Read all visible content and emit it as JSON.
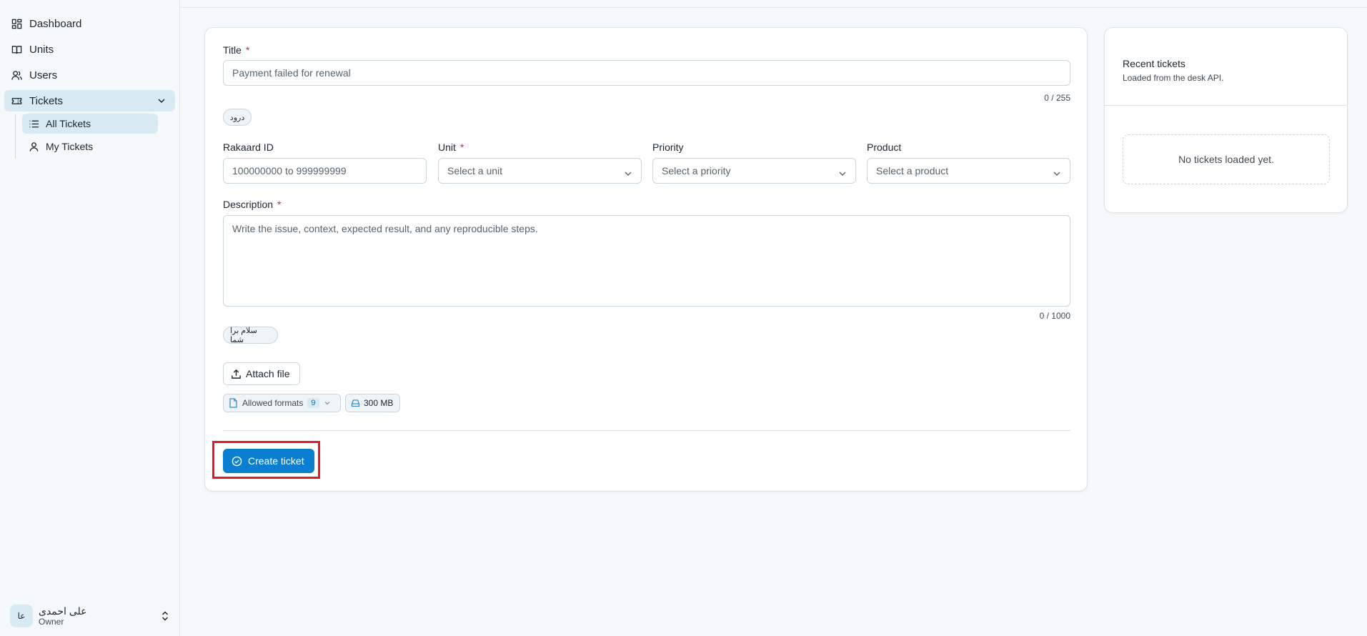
{
  "sidebar": {
    "items": [
      {
        "label": "Dashboard",
        "icon": "dashboard-icon"
      },
      {
        "label": "Units",
        "icon": "book-icon"
      },
      {
        "label": "Users",
        "icon": "users-icon"
      },
      {
        "label": "Tickets",
        "icon": "ticket-icon"
      }
    ],
    "tickets_sub": [
      {
        "label": "All Tickets",
        "icon": "list-icon"
      },
      {
        "label": "My Tickets",
        "icon": "user-icon"
      }
    ],
    "user": {
      "initials": "عا",
      "name": "علی احمدی",
      "role": "Owner"
    }
  },
  "form": {
    "title_label": "Title",
    "title_value": "Payment failed for renewal",
    "title_counter": "0 / 255",
    "title_chip": "درود",
    "rakaard_label": "Rakaard ID",
    "rakaard_placeholder": "100000000 to 999999999",
    "unit_label": "Unit",
    "unit_placeholder": "Select a unit",
    "priority_label": "Priority",
    "priority_placeholder": "Select a priority",
    "product_label": "Product",
    "product_placeholder": "Select a product",
    "description_label": "Description",
    "description_placeholder": "Write the issue, context, expected result, and any reproducible steps.",
    "description_counter": "0 / 1000",
    "description_chip": "سلام برا شما",
    "attach_label": "Attach file",
    "formats_label": "Allowed formats",
    "formats_count": "9",
    "size_label": "300 MB",
    "submit_label": "Create ticket",
    "required_mark": "*"
  },
  "recent": {
    "title": "Recent tickets",
    "subtitle": "Loaded from the desk API.",
    "empty": "No tickets loaded yet."
  },
  "colors": {
    "accent": "#0a7fd1",
    "highlight": "#e21a22",
    "required": "#e0232f"
  }
}
